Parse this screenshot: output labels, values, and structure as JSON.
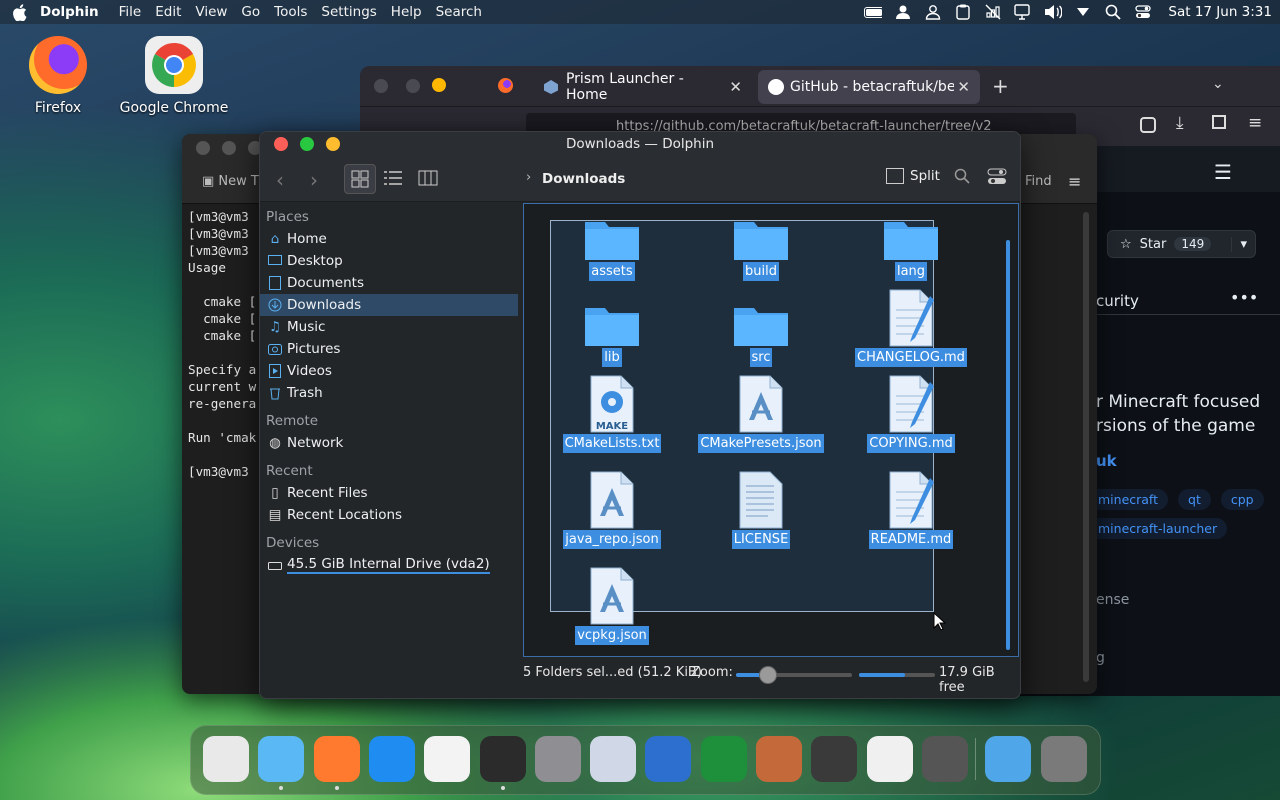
{
  "menubar": {
    "app_name": "Dolphin",
    "menus": [
      "File",
      "Edit",
      "View",
      "Go",
      "Tools",
      "Settings",
      "Help",
      "Search"
    ],
    "clock": "Sat 17 Jun 3:31"
  },
  "desktop": {
    "icons": [
      {
        "label": "Firefox",
        "icon": "firefox-icon"
      },
      {
        "label": "Google Chrome",
        "icon": "chrome-icon"
      }
    ]
  },
  "firefox": {
    "tabs": [
      {
        "label": "Prism Launcher - Home"
      },
      {
        "label": "GitHub - betacraftuk/betac"
      }
    ],
    "url": "https://github.com/betacraftuk/betacraft-launcher/tree/v2",
    "github": {
      "star_label": "Star",
      "star_count": "149",
      "security_fragment": "curity",
      "desc_line1": "r Minecraft focused",
      "desc_line2": "rsions of the game",
      "owner_fragment": "uk",
      "topics": [
        "minecraft",
        "qt",
        "cpp",
        "minecraft-launcher"
      ],
      "license_fragment": "ense",
      "bottom_fragment": "g"
    }
  },
  "terminal": {
    "tab_label": "New T",
    "find_label": "Find",
    "lines": [
      "[vm3@vm3",
      "[vm3@vm3",
      "[vm3@vm3",
      "Usage",
      "",
      "  cmake [",
      "  cmake [",
      "  cmake [",
      "",
      "Specify a",
      "current w",
      "re-genera",
      "",
      "Run 'cmak",
      "",
      "[vm3@vm3"
    ]
  },
  "dolphin": {
    "title": "Downloads — Dolphin",
    "breadcrumb": "Downloads",
    "split_label": "Split",
    "places": {
      "section_places": "Places",
      "items": [
        {
          "label": "Home",
          "icon": "home-icon"
        },
        {
          "label": "Desktop",
          "icon": "desktop-icon"
        },
        {
          "label": "Documents",
          "icon": "documents-icon"
        },
        {
          "label": "Downloads",
          "icon": "downloads-icon",
          "selected": true
        },
        {
          "label": "Music",
          "icon": "music-icon"
        },
        {
          "label": "Pictures",
          "icon": "pictures-icon"
        },
        {
          "label": "Videos",
          "icon": "videos-icon"
        },
        {
          "label": "Trash",
          "icon": "trash-icon"
        }
      ],
      "section_remote": "Remote",
      "remote_items": [
        {
          "label": "Network",
          "icon": "network-icon"
        }
      ],
      "section_recent": "Recent",
      "recent_items": [
        {
          "label": "Recent Files",
          "icon": "recent-files-icon"
        },
        {
          "label": "Recent Locations",
          "icon": "recent-locations-icon"
        }
      ],
      "section_devices": "Devices",
      "device_items": [
        {
          "label": "45.5 GiB Internal Drive (vda2)",
          "icon": "drive-icon"
        }
      ]
    },
    "files": [
      {
        "name": "assets",
        "type": "folder"
      },
      {
        "name": "build",
        "type": "folder"
      },
      {
        "name": "lang",
        "type": "folder"
      },
      {
        "name": "lib",
        "type": "folder"
      },
      {
        "name": "src",
        "type": "folder"
      },
      {
        "name": "CHANGELOG.md",
        "type": "text"
      },
      {
        "name": "CMakeLists.txt",
        "type": "cmake"
      },
      {
        "name": "CMakePresets.json",
        "type": "json"
      },
      {
        "name": "COPYING.md",
        "type": "text"
      },
      {
        "name": "java_repo.json",
        "type": "json"
      },
      {
        "name": "LICENSE",
        "type": "license"
      },
      {
        "name": "README.md",
        "type": "text"
      },
      {
        "name": "vcpkg.json",
        "type": "json"
      }
    ],
    "cmake_badge": "MAKE",
    "status": {
      "selection": "5 Folders sel...ed (51.2 KiB)",
      "zoom_label": "Zoom:",
      "zoom_fraction": 0.28,
      "free_fraction": 0.6,
      "free_space": "17.9 GiB free"
    }
  },
  "dock": {
    "items": [
      "launchpad-icon",
      "finder-icon",
      "firefox-icon",
      "app-store-icon",
      "photos-icon",
      "terminal-icon",
      "system-settings-icon",
      "screenshot-icon",
      "text-editor-icon",
      "spreadsheet-icon",
      "preview-icon",
      "tape-deck-icon",
      "notes-icon",
      "calculator-icon",
      "downloads-folder-icon",
      "trash-icon"
    ]
  },
  "colors": {
    "accent": "#3d8ee0",
    "selection": "#2f4a66",
    "folder": "#4aa3f0"
  }
}
